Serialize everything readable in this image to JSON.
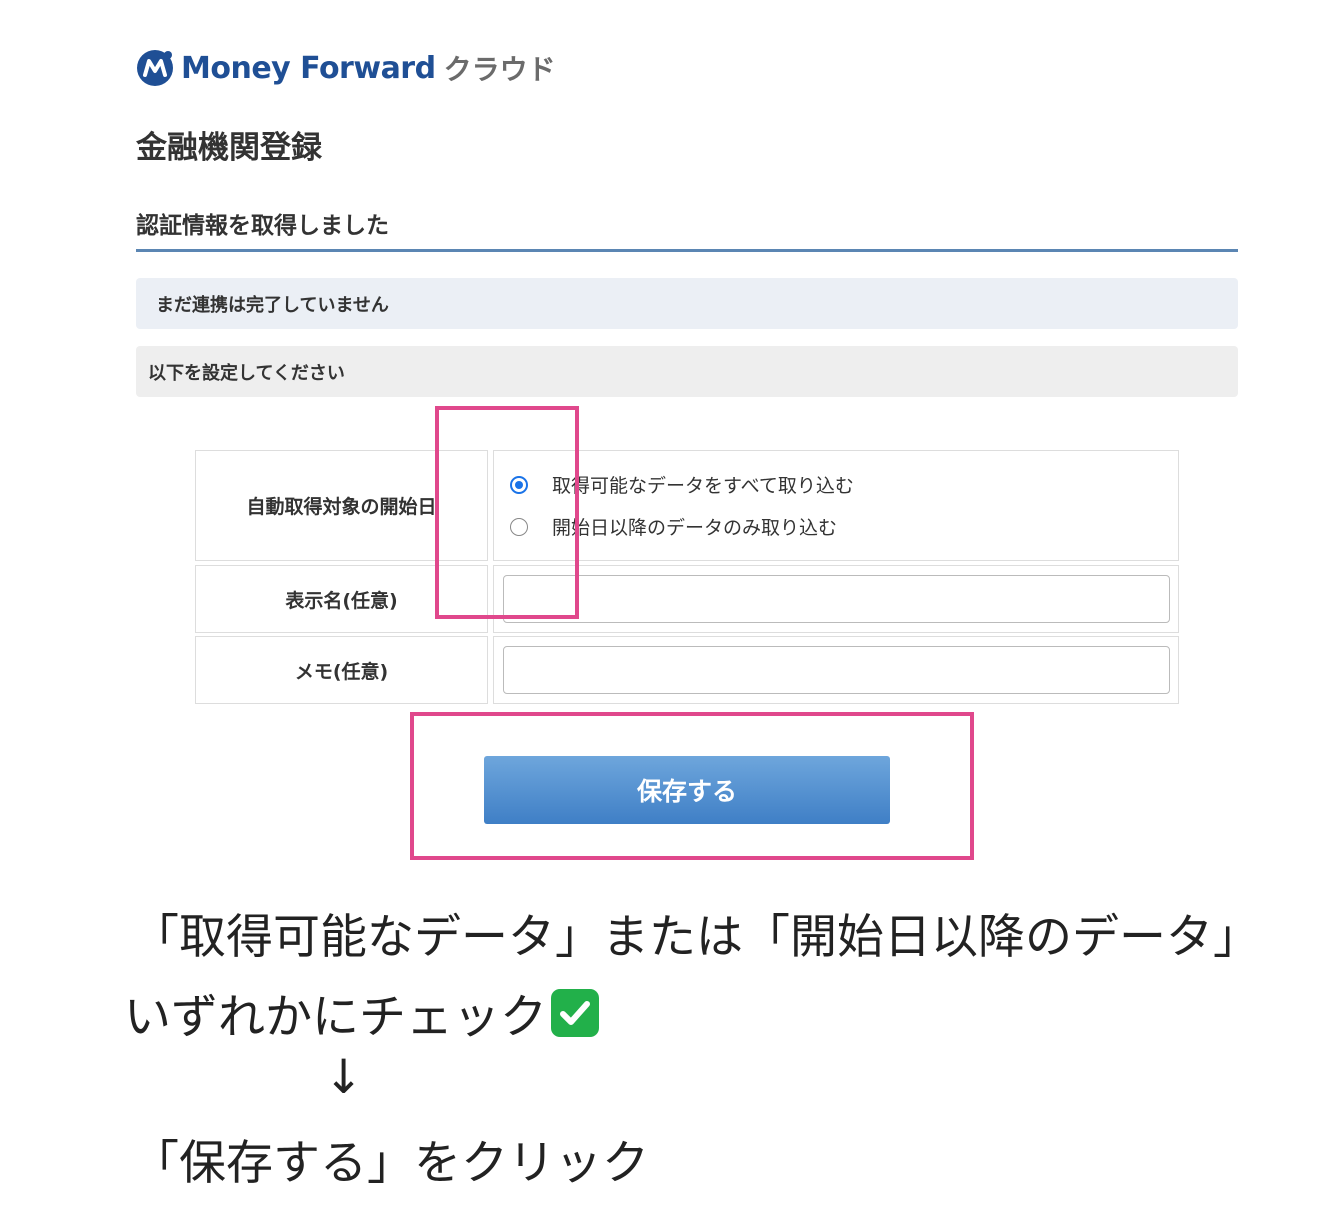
{
  "brand": {
    "name": "Money Forward",
    "suffix": "クラウド",
    "logo_icon": "money-forward-logo-icon",
    "color": "#1f4f95"
  },
  "page": {
    "title": "金融機関登録"
  },
  "section": {
    "title": "認証情報を取得しました",
    "rule_color": "#5b86b3"
  },
  "notices": {
    "not_linked": "まだ連携は完了していません",
    "please_set": "以下を設定してください"
  },
  "form": {
    "start_date": {
      "label": "自動取得対象の開始日",
      "options": [
        {
          "label": "取得可能なデータをすべて取り込む",
          "checked": true
        },
        {
          "label": "開始日以降のデータのみ取り込む",
          "checked": false
        }
      ]
    },
    "display_name": {
      "label": "表示名(任意)",
      "value": ""
    },
    "memo": {
      "label": "メモ(任意)",
      "value": ""
    }
  },
  "actions": {
    "save_label": "保存する",
    "button_color": "#4a8ad0"
  },
  "annotations": {
    "highlight_color": "#e0488c",
    "line1": "「取得可能なデータ」または「開始日以降のデータ」",
    "line2": "いずれかにチェック",
    "check_icon": "check-mark-button-icon",
    "arrow": "↓",
    "line3": "「保存する」をクリック"
  }
}
